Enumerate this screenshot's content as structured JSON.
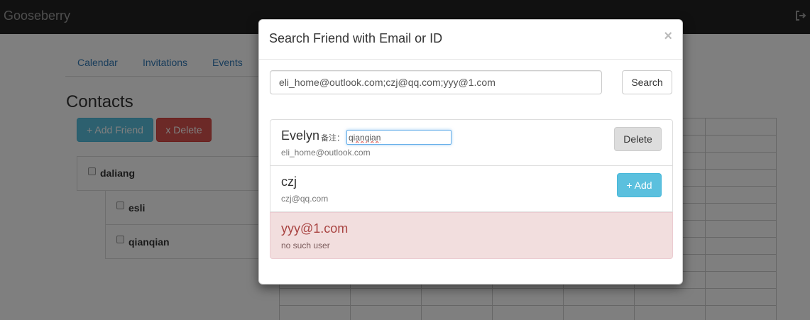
{
  "navbar": {
    "brand": "Gooseberry",
    "logout_icon": "logout-icon"
  },
  "tabs": [
    "Calendar",
    "Invitations",
    "Events"
  ],
  "page": {
    "title": "Contacts",
    "add_friend_label": "+ Add Friend",
    "delete_label": "x Delete"
  },
  "tree": [
    {
      "label": "daliang"
    },
    {
      "label": "esli"
    },
    {
      "label": "qianqian"
    }
  ],
  "modal": {
    "title": "Search Friend with Email or ID",
    "close_label": "×",
    "search": {
      "value": "eli_home@outlook.com;czj@qq.com;yyy@1.com",
      "button_label": "Search"
    },
    "results": [
      {
        "name": "Evelyn",
        "note_label": "备注：",
        "note_value": "qianqian",
        "email": "eli_home@outlook.com",
        "action_label": "Delete"
      },
      {
        "name": "czj",
        "email": "czj@qq.com",
        "action_label": "+ Add"
      },
      {
        "name": "yyy@1.com",
        "status": "no such user"
      }
    ]
  },
  "colors": {
    "navbar": "#222222",
    "info": "#5bc0de",
    "danger": "#d9534f",
    "danger_bg": "#f2dede"
  }
}
